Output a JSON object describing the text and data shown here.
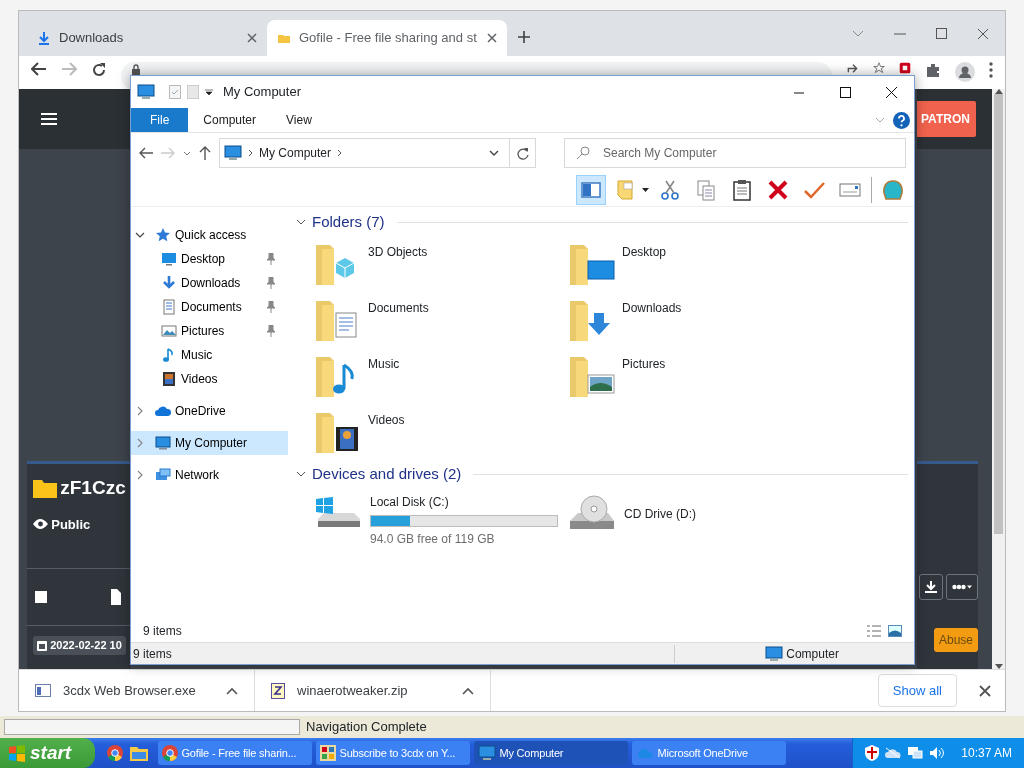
{
  "browser": {
    "tabs": [
      {
        "label": "Downloads",
        "kind": "download",
        "selected": false
      },
      {
        "label": "Gofile - Free file sharing and st",
        "kind": "gofile",
        "selected": true
      }
    ],
    "page": {
      "patron_button": "PATRON",
      "folder_name": "zF1Czc",
      "visibility": "Public",
      "select_checked": false,
      "date": "2022-02-22 10",
      "abuse_button": "Abuse"
    },
    "downloads": [
      {
        "name": "3cdx Web Browser.exe",
        "kind": "exe"
      },
      {
        "name": "winaerotweaker.zip",
        "kind": "zip"
      }
    ],
    "show_all": "Show all"
  },
  "explorer": {
    "title": "My Computer",
    "ribbon_tabs": [
      {
        "label": "File",
        "selected": true
      },
      {
        "label": "Computer",
        "selected": false
      },
      {
        "label": "View",
        "selected": false
      }
    ],
    "path": "My Computer",
    "search": {
      "placeholder": "Search My Computer"
    },
    "toolbar": [
      {
        "kind": "pane",
        "selected": true
      },
      {
        "kind": "note",
        "selected": false
      },
      {
        "kind": "cut",
        "selected": false
      },
      {
        "kind": "copy",
        "selected": false
      },
      {
        "kind": "paste",
        "selected": false
      },
      {
        "kind": "delete",
        "selected": false
      },
      {
        "kind": "check",
        "selected": false
      },
      {
        "kind": "mail",
        "selected": false
      },
      {
        "kind": "shell",
        "selected": false
      }
    ],
    "tree": [
      {
        "label": "Quick access",
        "kind": "star",
        "expanded": true,
        "selected": false,
        "children": [
          {
            "label": "Desktop",
            "kind": "desktop",
            "pinned": true,
            "selected": false
          },
          {
            "label": "Downloads",
            "kind": "download",
            "pinned": true,
            "selected": false
          },
          {
            "label": "Documents",
            "kind": "documents",
            "pinned": true,
            "selected": false
          },
          {
            "label": "Pictures",
            "kind": "pictures",
            "pinned": true,
            "selected": false
          },
          {
            "label": "Music",
            "kind": "music",
            "pinned": false,
            "selected": false
          },
          {
            "label": "Videos",
            "kind": "videos",
            "pinned": false,
            "selected": false
          }
        ]
      },
      {
        "label": "OneDrive",
        "kind": "cloud",
        "expanded": false,
        "selected": false
      },
      {
        "label": "My Computer",
        "kind": "computer",
        "expanded": false,
        "selected": true
      },
      {
        "label": "Network",
        "kind": "network",
        "expanded": false,
        "selected": false
      }
    ],
    "groups": [
      {
        "title": "Folders (7)",
        "expanded": true,
        "items": [
          {
            "name": "3D Objects",
            "kind": "cube"
          },
          {
            "name": "Desktop",
            "kind": "desktop"
          },
          {
            "name": "Documents",
            "kind": "documents"
          },
          {
            "name": "Downloads",
            "kind": "download"
          },
          {
            "name": "Music",
            "kind": "music"
          },
          {
            "name": "Pictures",
            "kind": "pictures"
          },
          {
            "name": "Videos",
            "kind": "videos"
          }
        ]
      },
      {
        "title": "Devices and drives (2)",
        "expanded": true,
        "items": [
          {
            "name": "Local Disk (C:)",
            "kind": "disk",
            "level": 0.21,
            "detail": "94.0 GB free of 119 GB"
          },
          {
            "name": "CD Drive (D:)",
            "kind": "cd"
          }
        ]
      }
    ],
    "item_count": "9 items",
    "status_count": "9 items",
    "status_location": "Computer"
  },
  "status_bar": "Navigation Complete",
  "taskbar": {
    "start": "start",
    "tasks": [
      {
        "label": "Gofile - Free file sharin...",
        "kind": "chrome",
        "selected": false
      },
      {
        "label": "Subscribe to 3cdx on Y...",
        "kind": "app",
        "selected": false
      },
      {
        "label": "My Computer",
        "kind": "computer",
        "selected": true
      },
      {
        "label": "Microsoft OneDrive",
        "kind": "cloud",
        "selected": false
      }
    ],
    "clock": "10:37 AM"
  }
}
